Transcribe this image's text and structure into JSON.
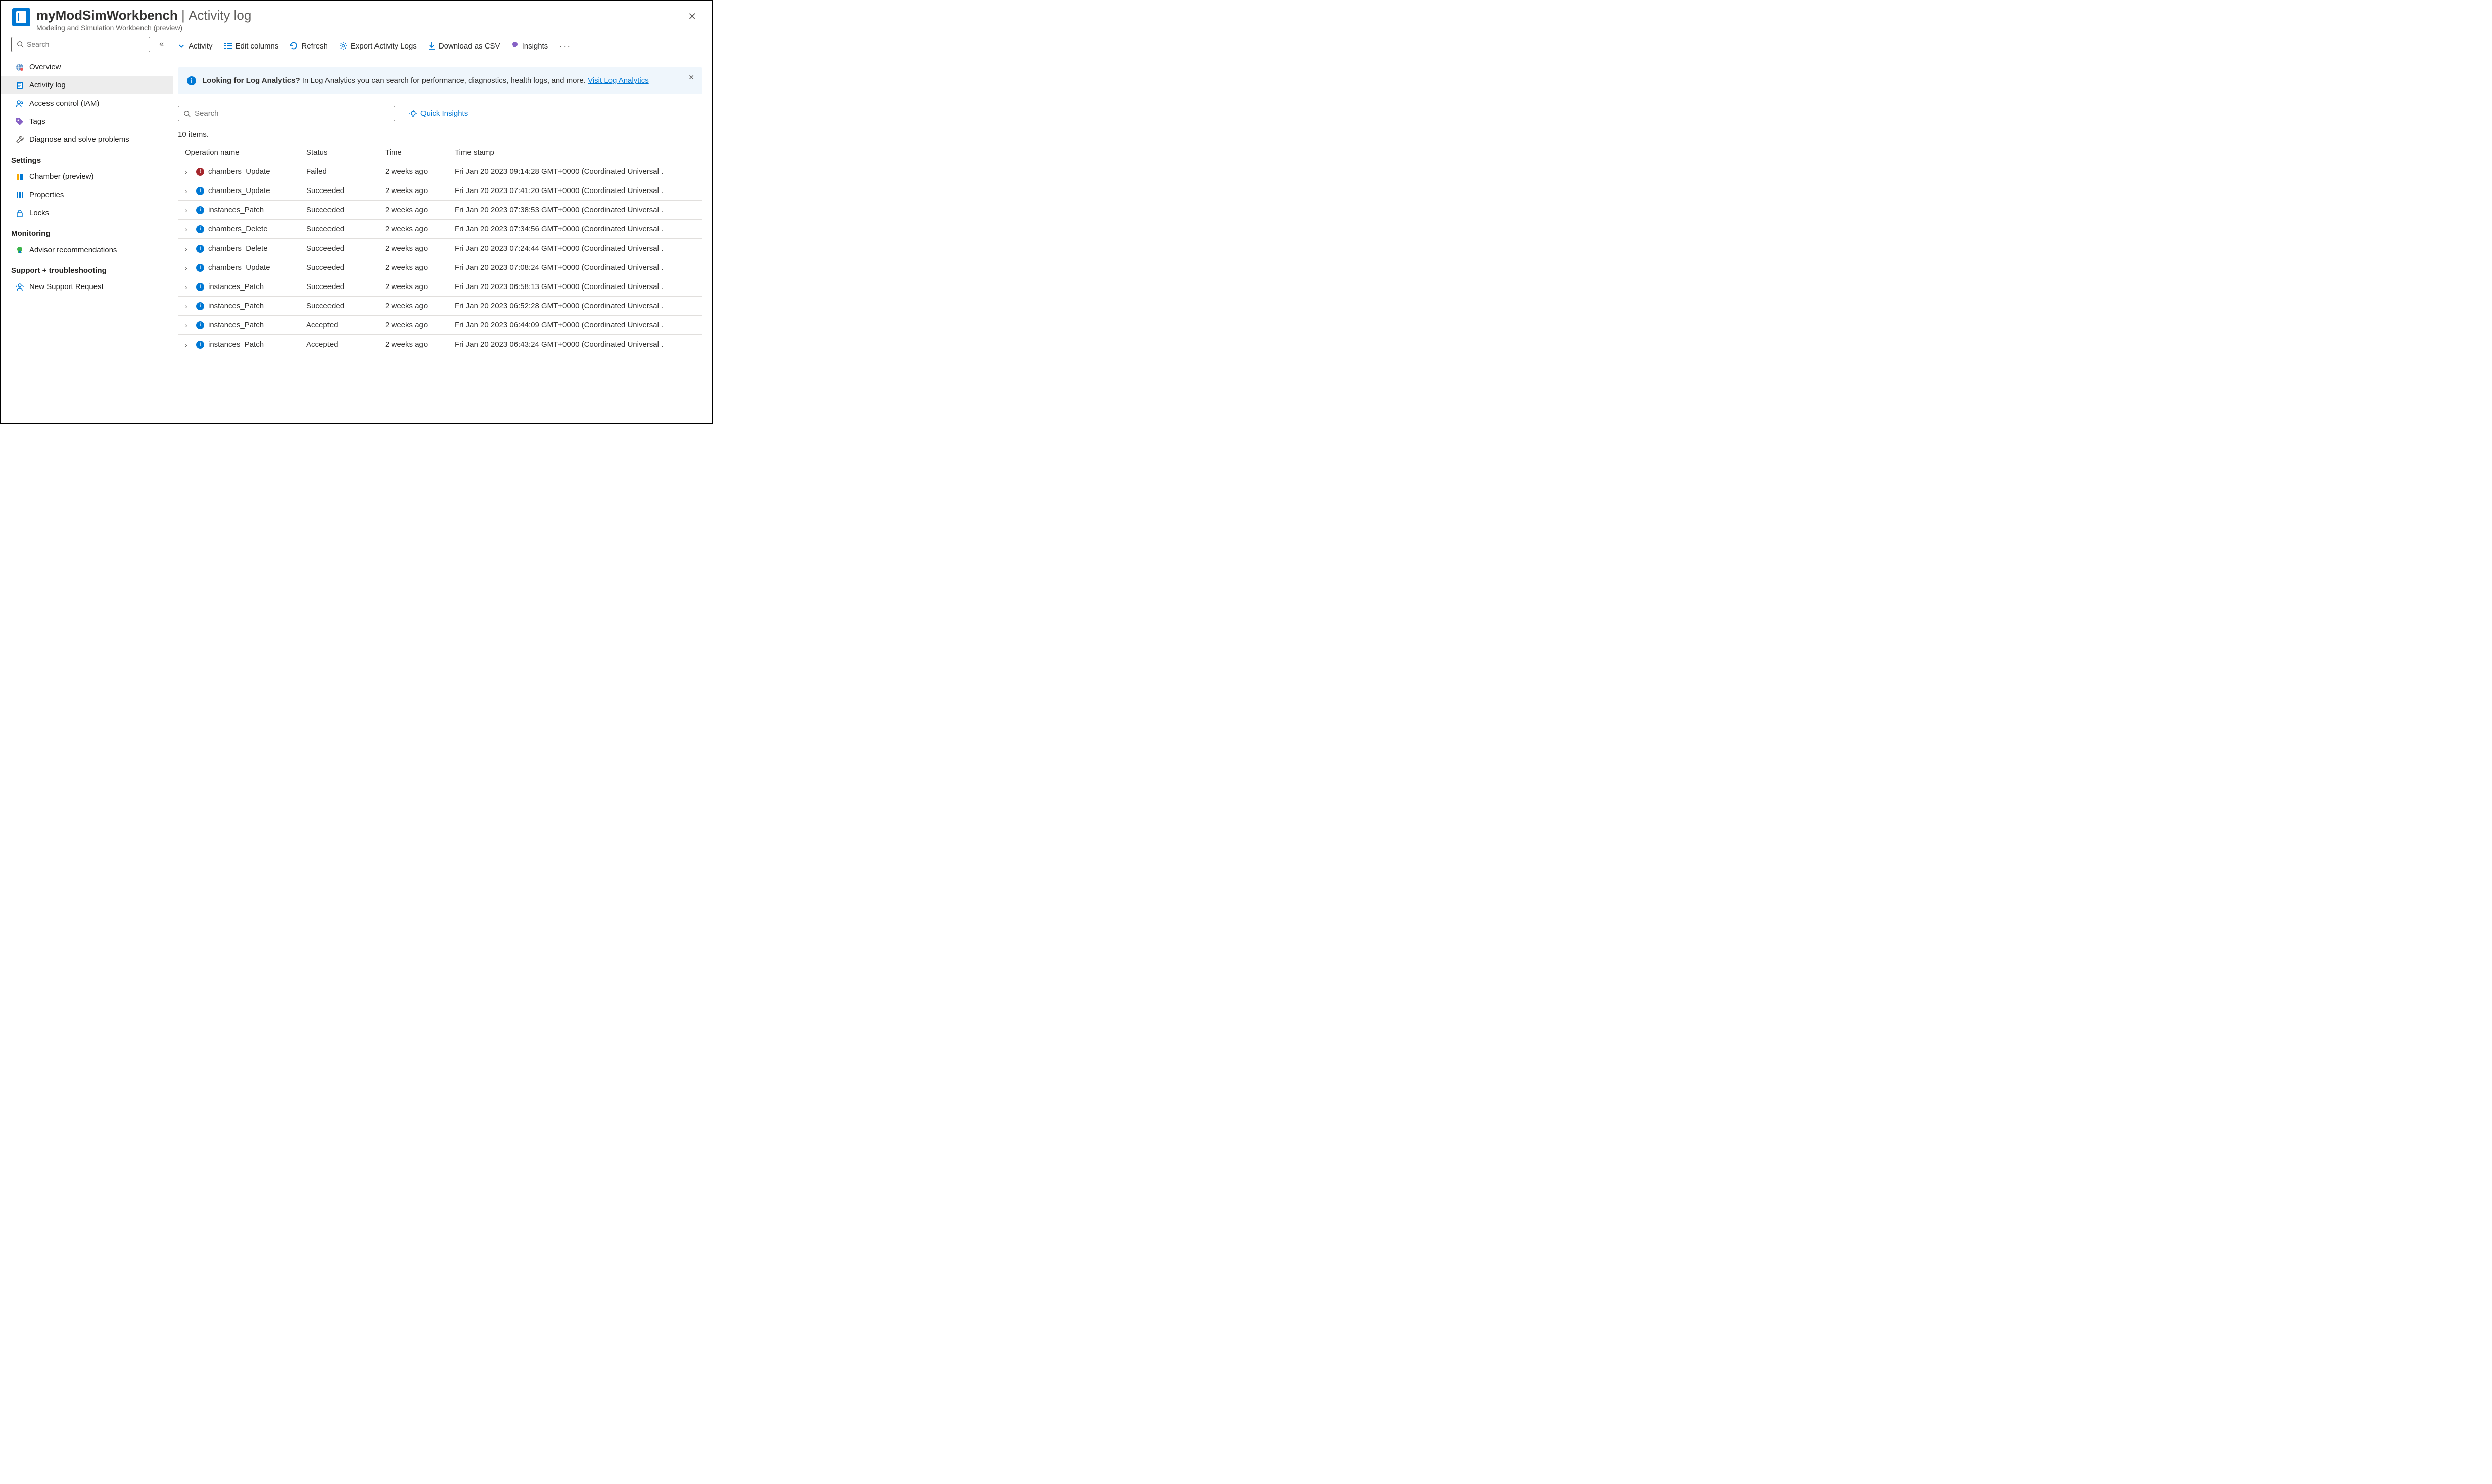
{
  "header": {
    "resource_name": "myModSimWorkbench",
    "separator": "|",
    "page": "Activity log",
    "subtitle": "Modeling and Simulation Workbench (preview)"
  },
  "sidebar": {
    "search_placeholder": "Search",
    "items_top": [
      {
        "id": "overview",
        "label": "Overview",
        "icon": "globe"
      },
      {
        "id": "activity-log",
        "label": "Activity log",
        "icon": "log",
        "active": true
      },
      {
        "id": "access-control",
        "label": "Access control (IAM)",
        "icon": "people"
      },
      {
        "id": "tags",
        "label": "Tags",
        "icon": "tag"
      },
      {
        "id": "diagnose",
        "label": "Diagnose and solve problems",
        "icon": "wrench"
      }
    ],
    "section_settings_label": "Settings",
    "items_settings": [
      {
        "id": "chamber",
        "label": "Chamber (preview)",
        "icon": "chamber"
      },
      {
        "id": "properties",
        "label": "Properties",
        "icon": "properties"
      },
      {
        "id": "locks",
        "label": "Locks",
        "icon": "lock"
      }
    ],
    "section_monitoring_label": "Monitoring",
    "items_monitoring": [
      {
        "id": "advisor",
        "label": "Advisor recommendations",
        "icon": "advisor"
      }
    ],
    "section_support_label": "Support + troubleshooting",
    "items_support": [
      {
        "id": "support",
        "label": "New Support Request",
        "icon": "support"
      }
    ]
  },
  "toolbar": {
    "activity": "Activity",
    "edit_columns": "Edit columns",
    "refresh": "Refresh",
    "export": "Export Activity Logs",
    "download_csv": "Download as CSV",
    "insights": "Insights"
  },
  "banner": {
    "title": "Looking for Log Analytics?",
    "body": "In Log Analytics you can search for performance, diagnostics, health logs, and more.",
    "link_text": "Visit Log Analytics"
  },
  "logs_search_placeholder": "Search",
  "quick_insights_label": "Quick Insights",
  "item_count_label": "10 items.",
  "columns": {
    "operation": "Operation name",
    "status": "Status",
    "time": "Time",
    "timestamp": "Time stamp"
  },
  "rows": [
    {
      "op": "chambers_Update",
      "status": "Failed",
      "status_kind": "failed",
      "time": "2 weeks ago",
      "ts": "Fri Jan 20 2023 09:14:28 GMT+0000 (Coordinated Universal ."
    },
    {
      "op": "chambers_Update",
      "status": "Succeeded",
      "status_kind": "info",
      "time": "2 weeks ago",
      "ts": "Fri Jan 20 2023 07:41:20 GMT+0000 (Coordinated Universal ."
    },
    {
      "op": "instances_Patch",
      "status": "Succeeded",
      "status_kind": "info",
      "time": "2 weeks ago",
      "ts": "Fri Jan 20 2023 07:38:53 GMT+0000 (Coordinated Universal ."
    },
    {
      "op": "chambers_Delete",
      "status": "Succeeded",
      "status_kind": "info",
      "time": "2 weeks ago",
      "ts": "Fri Jan 20 2023 07:34:56 GMT+0000 (Coordinated Universal ."
    },
    {
      "op": "chambers_Delete",
      "status": "Succeeded",
      "status_kind": "info",
      "time": "2 weeks ago",
      "ts": "Fri Jan 20 2023 07:24:44 GMT+0000 (Coordinated Universal ."
    },
    {
      "op": "chambers_Update",
      "status": "Succeeded",
      "status_kind": "info",
      "time": "2 weeks ago",
      "ts": "Fri Jan 20 2023 07:08:24 GMT+0000 (Coordinated Universal ."
    },
    {
      "op": "instances_Patch",
      "status": "Succeeded",
      "status_kind": "info",
      "time": "2 weeks ago",
      "ts": "Fri Jan 20 2023 06:58:13 GMT+0000 (Coordinated Universal ."
    },
    {
      "op": "instances_Patch",
      "status": "Succeeded",
      "status_kind": "info",
      "time": "2 weeks ago",
      "ts": "Fri Jan 20 2023 06:52:28 GMT+0000 (Coordinated Universal ."
    },
    {
      "op": "instances_Patch",
      "status": "Accepted",
      "status_kind": "info",
      "time": "2 weeks ago",
      "ts": "Fri Jan 20 2023 06:44:09 GMT+0000 (Coordinated Universal ."
    },
    {
      "op": "instances_Patch",
      "status": "Accepted",
      "status_kind": "info",
      "time": "2 weeks ago",
      "ts": "Fri Jan 20 2023 06:43:24 GMT+0000 (Coordinated Universal ."
    }
  ]
}
